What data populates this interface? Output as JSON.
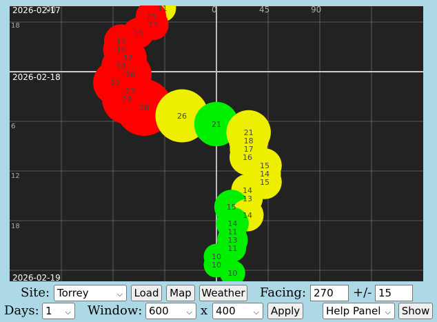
{
  "plot": {
    "date_labels": [
      "2026-02-17",
      "2026-02-18",
      "2026-02-19"
    ],
    "hour_labels": [
      "18",
      "6",
      "12",
      "18"
    ],
    "dir_labels": [
      "90",
      "0",
      "45",
      "90"
    ],
    "colors": {
      "background": "#222222",
      "grid": "#888888",
      "center_line": "#bbbbbb",
      "red": "#ff0000",
      "yellow": "#eeee00",
      "green": "#00ee00",
      "text": "#444444"
    },
    "points": [
      {
        "label": "11",
        "color": "yellow",
        "dir": -47,
        "hour": 0,
        "size": 11
      },
      {
        "label": "13",
        "color": "red",
        "dir": -57,
        "hour": 1,
        "size": 13
      },
      {
        "label": "13",
        "color": "red",
        "dir": -55,
        "hour": 2,
        "size": 13
      },
      {
        "label": "13",
        "color": "red",
        "dir": -68,
        "hour": 3,
        "size": 13
      },
      {
        "label": "15",
        "color": "red",
        "dir": -83,
        "hour": 4,
        "size": 15
      },
      {
        "label": "16",
        "color": "red",
        "dir": -83,
        "hour": 5,
        "size": 16
      },
      {
        "label": "17",
        "color": "red",
        "dir": -77,
        "hour": 6,
        "size": 17
      },
      {
        "label": "18",
        "color": "red",
        "dir": -83,
        "hour": 7,
        "size": 18
      },
      {
        "label": "20",
        "color": "red",
        "dir": -75,
        "hour": 8,
        "size": 20
      },
      {
        "label": "21",
        "color": "red",
        "dir": -88,
        "hour": 9,
        "size": 21
      },
      {
        "label": "23",
        "color": "red",
        "dir": -75,
        "hour": 10,
        "size": 23
      },
      {
        "label": "24",
        "color": "red",
        "dir": -78,
        "hour": 11,
        "size": 24
      },
      {
        "label": "28",
        "color": "red",
        "dir": -63,
        "hour": 12,
        "size": 28
      },
      {
        "label": "26",
        "color": "yellow",
        "dir": -30,
        "hour": 13,
        "size": 26
      },
      {
        "label": "21",
        "color": "green",
        "dir": 0,
        "hour": 14,
        "size": 21
      },
      {
        "label": "21",
        "color": "yellow",
        "dir": 28,
        "hour": 15,
        "size": 21
      },
      {
        "label": "18",
        "color": "yellow",
        "dir": 28,
        "hour": 16,
        "size": 18
      },
      {
        "label": "17",
        "color": "yellow",
        "dir": 28,
        "hour": 17,
        "size": 17
      },
      {
        "label": "16",
        "color": "yellow",
        "dir": 27,
        "hour": 18,
        "size": 16
      },
      {
        "label": "15",
        "color": "yellow",
        "dir": 42,
        "hour": 19,
        "size": 15
      },
      {
        "label": "14",
        "color": "yellow",
        "dir": 42,
        "hour": 20,
        "size": 14
      },
      {
        "label": "15",
        "color": "yellow",
        "dir": 42,
        "hour": 21,
        "size": 15
      },
      {
        "label": "14",
        "color": "yellow",
        "dir": 27,
        "hour": 22,
        "size": 14
      },
      {
        "label": "13",
        "color": "yellow",
        "dir": 27,
        "hour": 23,
        "size": 13
      },
      {
        "label": "15",
        "color": "green",
        "dir": 13,
        "hour": 24,
        "size": 15
      },
      {
        "label": "14",
        "color": "yellow",
        "dir": 27,
        "hour": 25,
        "size": 14
      },
      {
        "label": "14",
        "color": "green",
        "dir": 14,
        "hour": 26,
        "size": 14
      },
      {
        "label": "11",
        "color": "green",
        "dir": 14,
        "hour": 27,
        "size": 11
      },
      {
        "label": "13",
        "color": "green",
        "dir": 14,
        "hour": 28,
        "size": 13
      },
      {
        "label": "11",
        "color": "green",
        "dir": 14,
        "hour": 29,
        "size": 11
      },
      {
        "label": "10",
        "color": "green",
        "dir": 0,
        "hour": 30,
        "size": 10
      },
      {
        "label": "10",
        "color": "green",
        "dir": 0,
        "hour": 31,
        "size": 10
      },
      {
        "label": "10",
        "color": "green",
        "dir": 14,
        "hour": 32,
        "size": 10
      }
    ]
  },
  "controls": {
    "site_label": "Site:",
    "site_value": "Torrey",
    "load_label": "Load",
    "map_label": "Map",
    "weather_label": "Weather",
    "facing_label": "Facing:",
    "facing_value": "270",
    "tolerance_label": "+/-",
    "tolerance_value": "15",
    "days_label": "Days:",
    "days_value": "1",
    "window_label": "Window:",
    "window_width": "600",
    "x_label": "x",
    "window_height": "400",
    "apply_label": "Apply",
    "help_panel_value": "Help Panel",
    "show_label": "Show"
  }
}
